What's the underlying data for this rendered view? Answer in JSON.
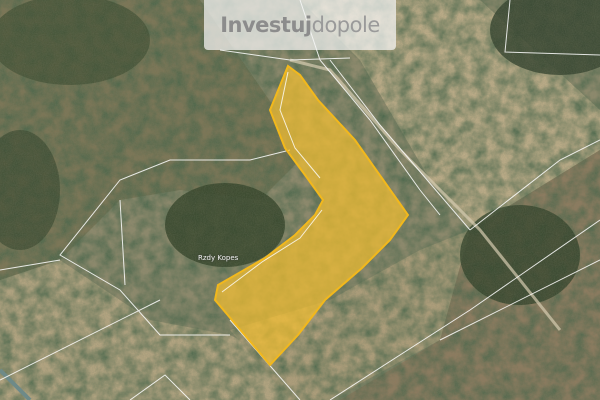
{
  "brand": {
    "part1": "Investuj",
    "part2": "dopole",
    "color_primary": "#8c8c8c"
  },
  "map": {
    "place_label": "Rzdy Kopes",
    "highlight_color": "#f6c030",
    "parcel_line_color": "#ffffff"
  }
}
